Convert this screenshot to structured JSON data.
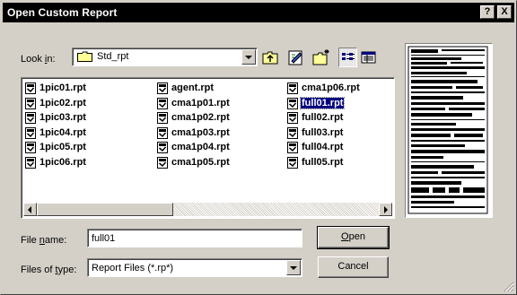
{
  "title": "Open Custom Report",
  "title_buttons": {
    "help": "?",
    "close": "X"
  },
  "look_in": {
    "label_pre": "Look ",
    "label_key": "i",
    "label_post": "n:",
    "value": "Std_rpt"
  },
  "toolbar": {
    "up": "up-one-level-icon",
    "favorites": "favorites-icon",
    "new_folder": "new-folder-icon",
    "list": "list-view-icon",
    "details": "details-view-icon"
  },
  "files": [
    "1pic01.rpt",
    "1pic02.rpt",
    "1pic03.rpt",
    "1pic04.rpt",
    "1pic05.rpt",
    "1pic06.rpt",
    "agent.rpt",
    "cma1p01.rpt",
    "cma1p02.rpt",
    "cma1p03.rpt",
    "cma1p04.rpt",
    "cma1p05.rpt",
    "cma1p06.rpt",
    "full01.rpt",
    "full02.rpt",
    "full03.rpt",
    "full04.rpt",
    "full05.rpt"
  ],
  "selected_file": "full01.rpt",
  "file_name": {
    "label_pre": "File ",
    "label_key": "n",
    "label_post": "ame:",
    "value": "full01"
  },
  "file_type": {
    "label_pre": "Files of ",
    "label_key": "t",
    "label_post": "ype:",
    "value": "Report Files (*.rp*)"
  },
  "buttons": {
    "open_key": "O",
    "open_rest": "pen",
    "cancel": "Cancel"
  }
}
